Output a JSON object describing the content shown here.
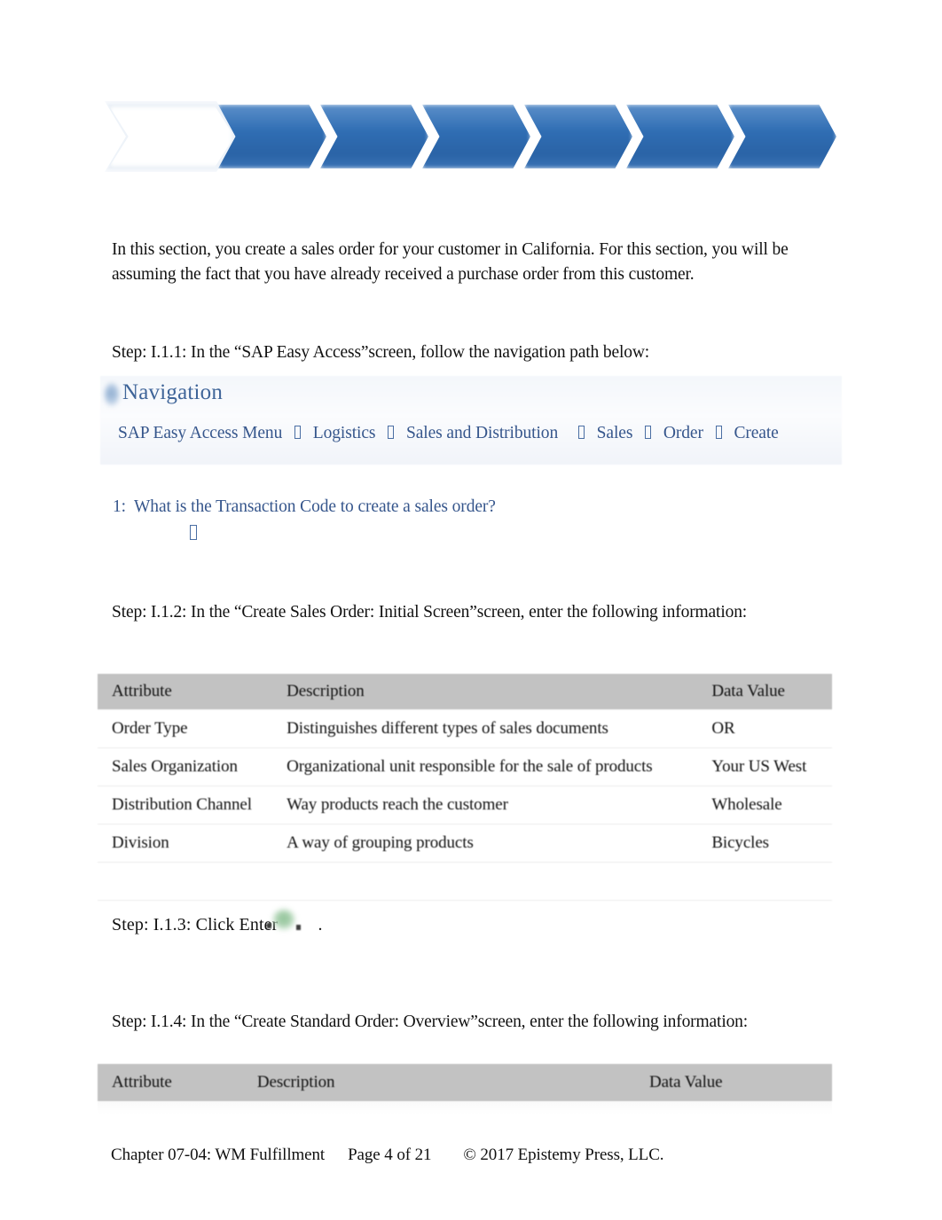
{
  "document": {
    "banner": {
      "name": "process-chevron-banner",
      "steps": [
        {
          "filled": false
        },
        {
          "filled": true
        },
        {
          "filled": true
        },
        {
          "filled": true
        },
        {
          "filled": true
        },
        {
          "filled": true
        },
        {
          "filled": true
        }
      ],
      "accent_color": "#2f6db3",
      "empty_color": "#ffffff"
    },
    "intro_paragraph": "In this section, you create a sales order for your customer in California. For this section, you will be assuming the fact that you have already received a purchase order from this customer.",
    "steps": {
      "step_1_1_1": "Step: I.1.1: In the “SAP Easy Access”screen, follow the navigation path below:",
      "step_1_1_2": "Step: I.1.2: In the “Create Sales Order: Initial Screen”screen, enter the following information:",
      "step_1_1_3_prefix": "Step: I.1.3: Click Enter",
      "step_1_1_3_suffix": ".",
      "step_1_1_4": "Step: I.1.4: In the “Create Standard Order: Overview”screen, enter the following information:"
    },
    "navigation_box": {
      "title": "Navigation",
      "accent_color": "#3f6599",
      "path": [
        "SAP Easy Access Menu",
        "Logistics",
        "Sales and Distribution",
        "Sales",
        "Order",
        "Create"
      ],
      "separator_icon": "missing-glyph-box"
    },
    "question": {
      "number": "1:",
      "text": "What is the Transaction Code to create a sales order?",
      "answer": "",
      "answer_icon": "missing-glyph-box",
      "color": "#36568c"
    },
    "table_initial_screen": {
      "caption": "Create Sales Order: Initial Screen",
      "columns": [
        "Attribute",
        "Description",
        "Data Value"
      ],
      "rows": [
        [
          "Order Type",
          "Distinguishes different types of sales documents",
          "OR"
        ],
        [
          "Sales Organization",
          "Organizational unit responsible for the sale of products",
          "Your US West"
        ],
        [
          "Distribution Channel",
          "Way products reach the customer",
          "Wholesale"
        ],
        [
          "Division",
          "A way of grouping products",
          "Bicycles"
        ]
      ],
      "header_bg": "#c2c2c2"
    },
    "table_overview": {
      "caption": "Create Standard Order: Overview",
      "columns": [
        "Attribute",
        "Description",
        "Data Value"
      ],
      "rows": [],
      "header_bg": "#c2c2c2"
    },
    "enter_icon_name": "sap-enter-green-check-icon",
    "footer": {
      "chapter": "Chapter 07-04: WM Fulfillment",
      "page": "Page 4 of 21",
      "copyright": "© 2017 Epistemy Press, LLC."
    }
  }
}
